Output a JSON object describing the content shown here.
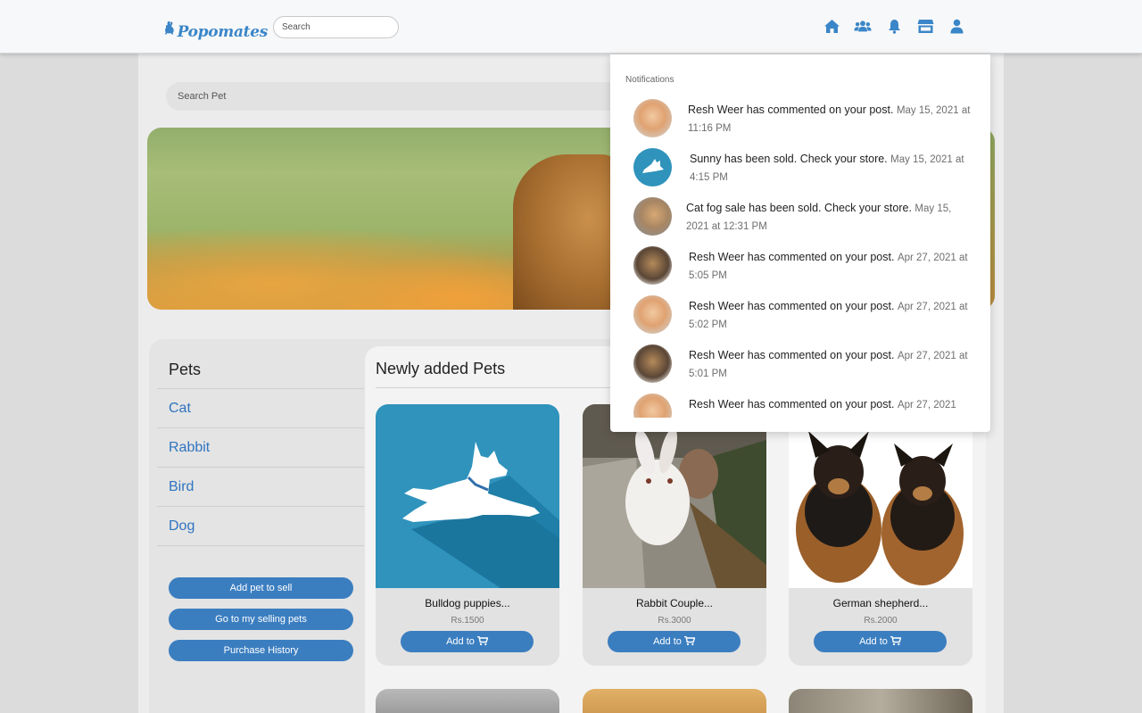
{
  "app": {
    "brand": "Popomates"
  },
  "navbar": {
    "search_placeholder": "Search",
    "icons": [
      "home-icon",
      "friends-icon",
      "bell-icon",
      "store-icon",
      "user-icon"
    ],
    "accent": "#3a86c8"
  },
  "main": {
    "search_pet_placeholder": "Search Pet"
  },
  "sidebar": {
    "title": "Pets",
    "categories": [
      "Cat",
      "Rabbit",
      "Bird",
      "Dog"
    ],
    "buttons": {
      "add_pet": "Add pet to sell",
      "my_selling": "Go to my selling pets",
      "history": "Purchase History"
    }
  },
  "pets": {
    "title": "Newly added Pets",
    "add_label": "Add to",
    "cards": [
      {
        "title": "Bulldog puppies...",
        "price": "Rs.1500"
      },
      {
        "title": "Rabbit Couple...",
        "price": "Rs.3000"
      },
      {
        "title": "German shepherd...",
        "price": "Rs.2000"
      }
    ]
  },
  "notifications": {
    "title": "Notifications",
    "items": [
      {
        "text": "Resh Weer has commented on your post.",
        "time": "May 15, 2021 at 11:16 PM"
      },
      {
        "text": "Sunny has been sold. Check your store.",
        "time": "May 15, 2021 at 4:15 PM"
      },
      {
        "text": "Cat fog sale has been sold. Check your store.",
        "time": "May 15, 2021 at 12:31 PM"
      },
      {
        "text": "Resh Weer has commented on your post.",
        "time": "Apr 27, 2021 at 5:05 PM"
      },
      {
        "text": "Resh Weer has commented on your post.",
        "time": "Apr 27, 2021 at 5:02 PM"
      },
      {
        "text": "Resh Weer has commented on your post.",
        "time": "Apr 27, 2021 at 5:01 PM"
      },
      {
        "text": "Resh Weer has commented on your post.",
        "time": "Apr 27, 2021"
      }
    ]
  }
}
